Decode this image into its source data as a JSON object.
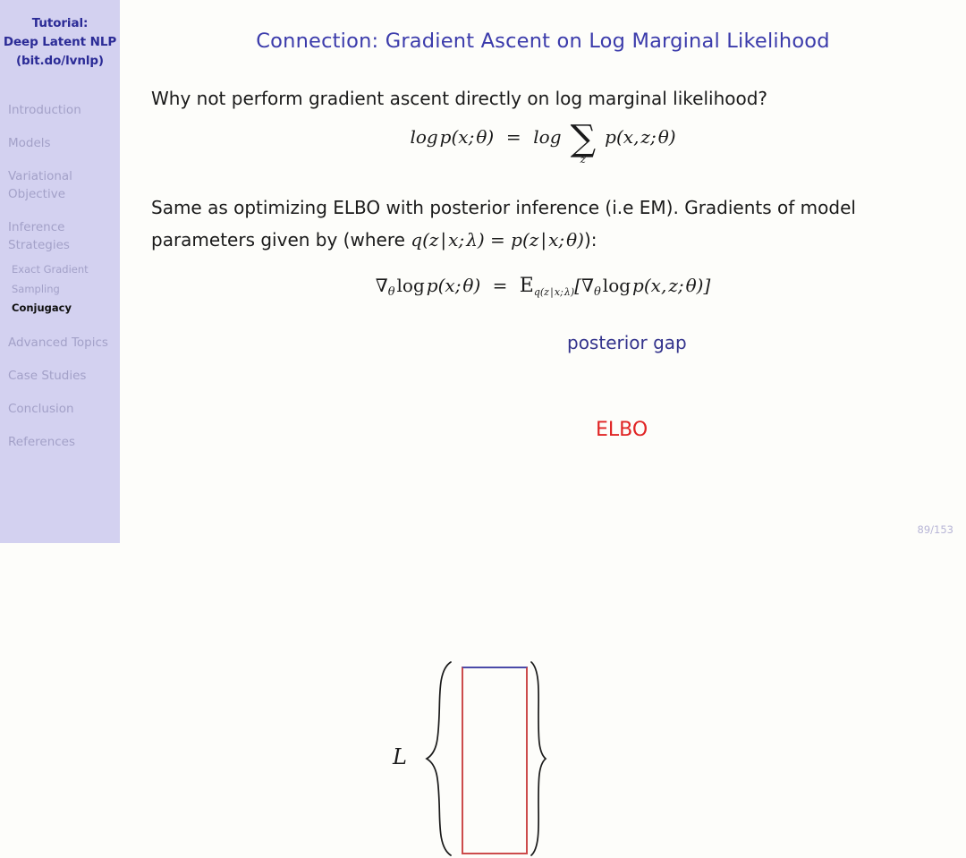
{
  "sidebar": {
    "header_lines": [
      "Tutorial:",
      "Deep Latent NLP",
      "(bit.do/lvnlp)"
    ],
    "sections": [
      {
        "lines": [
          "Introduction"
        ],
        "active": false
      },
      {
        "lines": [
          "Models"
        ],
        "active": false
      },
      {
        "lines": [
          "Variational",
          "Objective"
        ],
        "active": false
      },
      {
        "lines": [
          "Inference",
          "Strategies"
        ],
        "active": false
      }
    ],
    "subitems": [
      {
        "label": "Exact Gradient",
        "active": false
      },
      {
        "label": "Sampling",
        "active": false
      },
      {
        "label": "Conjugacy",
        "active": true
      }
    ],
    "sections_after": [
      {
        "lines": [
          "Advanced Topics"
        ],
        "active": false
      },
      {
        "lines": [
          "Case Studies"
        ],
        "active": false
      },
      {
        "lines": [
          "Conclusion"
        ],
        "active": false
      },
      {
        "lines": [
          "References"
        ],
        "active": false
      }
    ]
  },
  "slide": {
    "title": "Connection: Gradient Ascent on Log Marginal Likelihood",
    "paragraph1": "Why not perform gradient ascent directly on log marginal likelihood?",
    "paragraph2_part1": "Same as optimizing ELBO with posterior inference (i.e EM). Gradients of model parameters given by (where ",
    "paragraph2_math": "q(z | x; λ) = p(z | x; θ)",
    "paragraph2_part2": "):",
    "equation1": {
      "lhs": "log p(x; θ)",
      "eq": "=",
      "rhs_prefix": "log",
      "sum_symbol": "∑",
      "sum_subscript": "z",
      "rhs_suffix": "p(x, z; θ)"
    },
    "equation2": {
      "lhs": "∇θ log p(x; θ)",
      "eq": "=",
      "expectation": "𝔼",
      "expectation_subscript": "q(z | x; λ)",
      "bracket_content": "[∇θ log p(x, z; θ)]"
    },
    "diagram": {
      "left_label": "L",
      "posterior_gap_label": "posterior gap",
      "elbo_label": "ELBO",
      "box_top_border_color": "#4a4aa8",
      "box_side_border_color": "#cc4b4b"
    },
    "page_number": "89/153"
  },
  "colors": {
    "sidebar_bg": "#d3d1f0",
    "sidebar_header_text": "#2b2b96",
    "sidebar_item_text": "#a3a1c8",
    "sidebar_active_text": "#101010",
    "title_text": "#3b3bab",
    "body_text": "#1a1a1a",
    "page_bg": "#fdfdfa",
    "elbo_red": "#e02424",
    "posterior_blue": "#33338c",
    "page_number_text": "#b7b5d6"
  }
}
